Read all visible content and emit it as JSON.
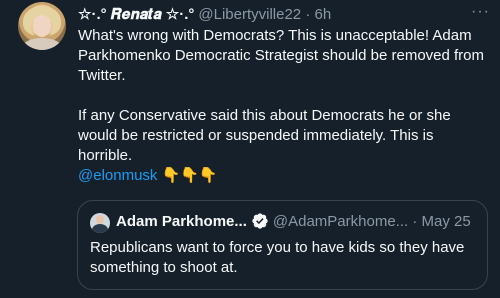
{
  "tweet": {
    "display_name": "☆·.° 𝑹𝒆𝒏𝒂𝒕𝒂 ☆·.°",
    "handle_time": "@Libertyville22 · 6h",
    "more_icon": "···",
    "paragraph1": "What's wrong with Democrats? This is unacceptable! Adam Parkhomenko Democratic Strategist should be removed from Twitter.",
    "paragraph2": "If any Conservative said this about Democrats he or she would be restricted or suspended immediately. This is horrible.",
    "mention": "@elonmusk",
    "emojis": "👇👇👇"
  },
  "quoted": {
    "name": "Adam Parkhome...",
    "handle_date": "@AdamParkhome... · May 25",
    "text": "Republicans want to force you to have kids so they have something to shoot at."
  },
  "colors": {
    "background": "#15202b",
    "text": "#f7f9f9",
    "secondary": "#8b98a5",
    "accent": "#1d9bf0",
    "border": "#38444d"
  },
  "icons": {
    "more": "more-options-icon",
    "verified": "verified-badge-icon"
  }
}
